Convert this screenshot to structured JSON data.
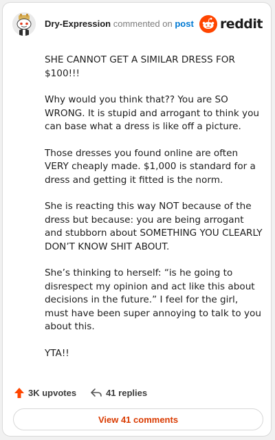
{
  "header": {
    "username": "Dry-Expression",
    "commented_text": "commented on",
    "post_link": "post",
    "brand": "reddit"
  },
  "comment": {
    "paragraphs": [
      "SHE CANNOT GET A SIMILAR DRESS FOR $100!!!",
      "Why would you think that?? You are SO WRONG. It is stupid and arrogant to think you can base what a dress is like off a picture.",
      "Those dresses you found online are often VERY cheaply made. $1,000 is standard for a dress and getting it fitted is the norm.",
      "She is reacting this way NOT because of the dress but because: you are being arrogant and stubborn about SOMETHING YOU CLEARLY DON’T KNOW SHIT ABOUT.",
      "She’s thinking to herself: “is he going to disrespect my opinion and act like this about decisions in the future.” I feel for the girl, must have been super annoying to talk to you about this.",
      "YTA!!"
    ]
  },
  "actions": {
    "upvotes": "3K upvotes",
    "replies": "41 replies"
  },
  "footer": {
    "view_comments": "View 41 comments"
  },
  "colors": {
    "accent": "#ff4500",
    "link": "#0079d3",
    "button_text": "#d93a00"
  },
  "icons": {
    "upvote": "upvote-arrow-icon",
    "reply": "reply-arrow-icon",
    "brand": "reddit-logo-icon",
    "avatar": "snoo-avatar"
  }
}
